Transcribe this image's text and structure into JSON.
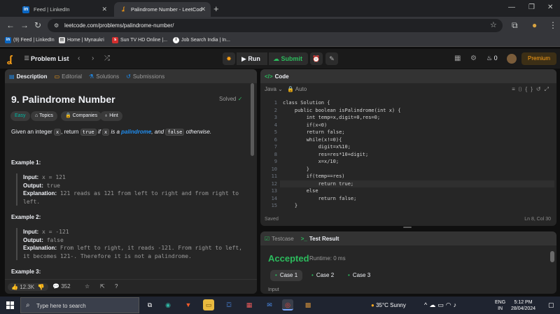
{
  "browser": {
    "tabs": [
      {
        "title": "Feed | LinkedIn"
      },
      {
        "title": "Palindrome Number - LeetCod"
      }
    ],
    "url": "leetcode.com/problems/palindrome-number/",
    "bookmarks": [
      {
        "label": "(9) Feed | LinkedIn"
      },
      {
        "label": "Home | Mynaukri"
      },
      {
        "label": "Sun TV HD Online |..."
      },
      {
        "label": "Job Search India | In..."
      }
    ]
  },
  "nav": {
    "problem_list": "Problem List",
    "run": "Run",
    "submit": "Submit",
    "streak": "0",
    "premium": "Premium"
  },
  "left_tabs": [
    {
      "label": "Description"
    },
    {
      "label": "Editorial"
    },
    {
      "label": "Solutions"
    },
    {
      "label": "Submissions"
    }
  ],
  "problem": {
    "title": "9. Palindrome Number",
    "solved": "Solved",
    "difficulty": "Easy",
    "topics": "Topics",
    "companies": "Companies",
    "hint": "Hint",
    "desc_pre": "Given an integer ",
    "desc_x": "x",
    "desc_mid": ", return ",
    "desc_true": "true",
    "desc_if": " if ",
    "desc_x2": "x",
    "desc_isa": " is a ",
    "desc_link": "palindrome",
    "desc_and": ", and ",
    "desc_false": "false",
    "desc_end": " otherwise.",
    "examples": [
      {
        "heading": "Example 1:",
        "input_label": "Input:",
        "input": "x = 121",
        "output_label": "Output:",
        "output": "true",
        "expl_label": "Explanation:",
        "expl": "121 reads as 121 from left to right and from right to left."
      },
      {
        "heading": "Example 2:",
        "input_label": "Input:",
        "input": "x = -121",
        "output_label": "Output:",
        "output": "false",
        "expl_label": "Explanation:",
        "expl": "From left to right, it reads -121. From right to left, it becomes 121-. Therefore it is not a palindrome."
      },
      {
        "heading": "Example 3:"
      }
    ],
    "likes": "12.3K",
    "comments": "352"
  },
  "code": {
    "tab": "Code",
    "language": "Java",
    "auto": "Auto",
    "lines": [
      {
        "n": "1",
        "t": "class Solution {"
      },
      {
        "n": "2",
        "t": "    public boolean isPalindrome(int x) {"
      },
      {
        "n": "3",
        "t": "        int temp=x,digit=0,res=0;"
      },
      {
        "n": "4",
        "t": "        if(x<0)"
      },
      {
        "n": "5",
        "t": "        return false;"
      },
      {
        "n": "6",
        "t": "        while(x!=0){"
      },
      {
        "n": "7",
        "t": "            digit=x%10;"
      },
      {
        "n": "8",
        "t": "            res=res*10+digit;"
      },
      {
        "n": "9",
        "t": "            x=x/10;"
      },
      {
        "n": "10",
        "t": "        }"
      },
      {
        "n": "11",
        "t": "        if(temp==res)"
      },
      {
        "n": "12",
        "t": "            return true;"
      },
      {
        "n": "13",
        "t": "        else"
      },
      {
        "n": "14",
        "t": "            return false;"
      },
      {
        "n": "15",
        "t": "    }"
      }
    ],
    "saved": "Saved",
    "cursor": "Ln 8, Col 30"
  },
  "test": {
    "tab_case": "Testcase",
    "tab_result": "Test Result",
    "status": "Accepted",
    "runtime": "Runtime: 0 ms",
    "cases": [
      {
        "label": "Case 1"
      },
      {
        "label": "Case 2"
      },
      {
        "label": "Case 3"
      }
    ],
    "input_label": "Input"
  },
  "taskbar": {
    "search": "Type here to search",
    "weather": "35°C Sunny",
    "lang1": "ENG",
    "lang2": "IN",
    "time": "5:12 PM",
    "date": "28/04/2024"
  },
  "colors": {
    "accent": "#ffa116",
    "accepted": "#2cbb5d",
    "easy": "#00b8a3",
    "link": "#1f8ef1"
  }
}
